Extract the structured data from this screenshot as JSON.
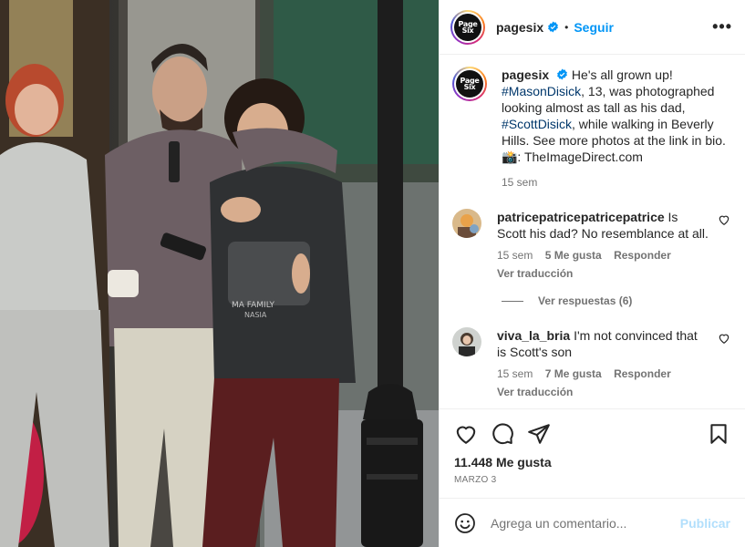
{
  "post": {
    "account": "pagesix",
    "logo_text": "Page Six",
    "follow_label": "Seguir",
    "more_label": "•••",
    "caption": {
      "username": "pagesix",
      "text_start": "He's all grown up! ",
      "tag1": "#MasonDisick",
      "text_mid": ", 13, was photographed looking almost as tall as his dad, ",
      "tag2": "#ScottDisick",
      "text_end": ", while walking in Beverly Hills. See more photos at the link in bio. 📸: TheImageDirect.com",
      "time": "15 sem"
    },
    "comments": [
      {
        "username": "patricepatricepatricepatrice",
        "text": "Is Scott his dad? No resemblance at all.",
        "time": "15 sem",
        "likes": "5 Me gusta",
        "reply_label": "Responder",
        "translate_label": "Ver traducción",
        "replies_label": "Ver respuestas (6)"
      },
      {
        "username": "viva_la_bria",
        "text": "I'm not convinced that is Scott's son",
        "time": "15 sem",
        "likes": "7 Me gusta",
        "reply_label": "Responder",
        "translate_label": "Ver traducción"
      }
    ],
    "likes_count": "11.448 Me gusta",
    "date": "MARZO 3",
    "comment_placeholder": "Agrega un comentario...",
    "publish_label": "Publicar"
  },
  "photo": {
    "shirt_print_1": "MA FAMILY",
    "shirt_print_2": "NASIA"
  },
  "colors": {
    "accent": "#0095f6",
    "link": "#00376b",
    "muted": "#737373",
    "publish_disabled": "#b2dffc"
  },
  "icons": [
    "verified-badge-icon",
    "more-options-icon",
    "heart-icon",
    "comment-icon",
    "share-icon",
    "save-icon",
    "emoji-icon"
  ]
}
